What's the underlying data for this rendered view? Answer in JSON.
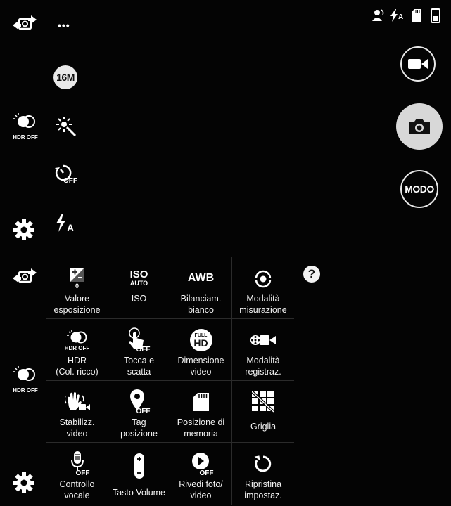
{
  "top_left": {
    "switch_camera_icon": "switch-camera-icon",
    "more_label": "•••"
  },
  "left_quick": {
    "resolution": "16M",
    "hdr_label": "HDR OFF",
    "timer_label": "OFF",
    "flash_label": "A"
  },
  "status_bar": {
    "flash_auto_label": "A"
  },
  "right_controls": {
    "mode_label": "MODO"
  },
  "help_label": "?",
  "left_second": {
    "hdr_label": "HDR OFF"
  },
  "settings_grid": [
    {
      "name": "exposure",
      "icon_text": "0",
      "label": "Valore\nesposizione"
    },
    {
      "name": "iso",
      "icon_text": "ISO",
      "icon_sub": "AUTO",
      "label": "ISO"
    },
    {
      "name": "white-balance",
      "icon_text": "AWB",
      "label": "Bilanciam.\nbianco"
    },
    {
      "name": "metering",
      "label": "Modalità\nmisurazione"
    },
    {
      "name": "hdr",
      "icon_text": "HDR OFF",
      "label": "HDR\n(Col. ricco)"
    },
    {
      "name": "touch-shoot",
      "icon_text": "OFF",
      "label": "Tocca e\nscatta"
    },
    {
      "name": "video-size",
      "icon_text": "FULL",
      "icon_sub": "HD",
      "label": "Dimensione\nvideo"
    },
    {
      "name": "recording-mode",
      "label": "Modalità\nregistraz."
    },
    {
      "name": "video-stabilization",
      "label": "Stabilizz.\nvideo"
    },
    {
      "name": "location-tag",
      "icon_text": "OFF",
      "label": "Tag\nposizione"
    },
    {
      "name": "storage",
      "label": "Posizione di\nmemoria"
    },
    {
      "name": "grid",
      "label": "Griglia"
    },
    {
      "name": "voice-control",
      "icon_text": "OFF",
      "label": "Controllo\nvocale"
    },
    {
      "name": "volume-key",
      "label": "Tasto Volume"
    },
    {
      "name": "review",
      "icon_text": "OFF",
      "label": "Rivedi foto/\nvideo"
    },
    {
      "name": "reset",
      "label": "Ripristina\nimpostaz."
    }
  ]
}
